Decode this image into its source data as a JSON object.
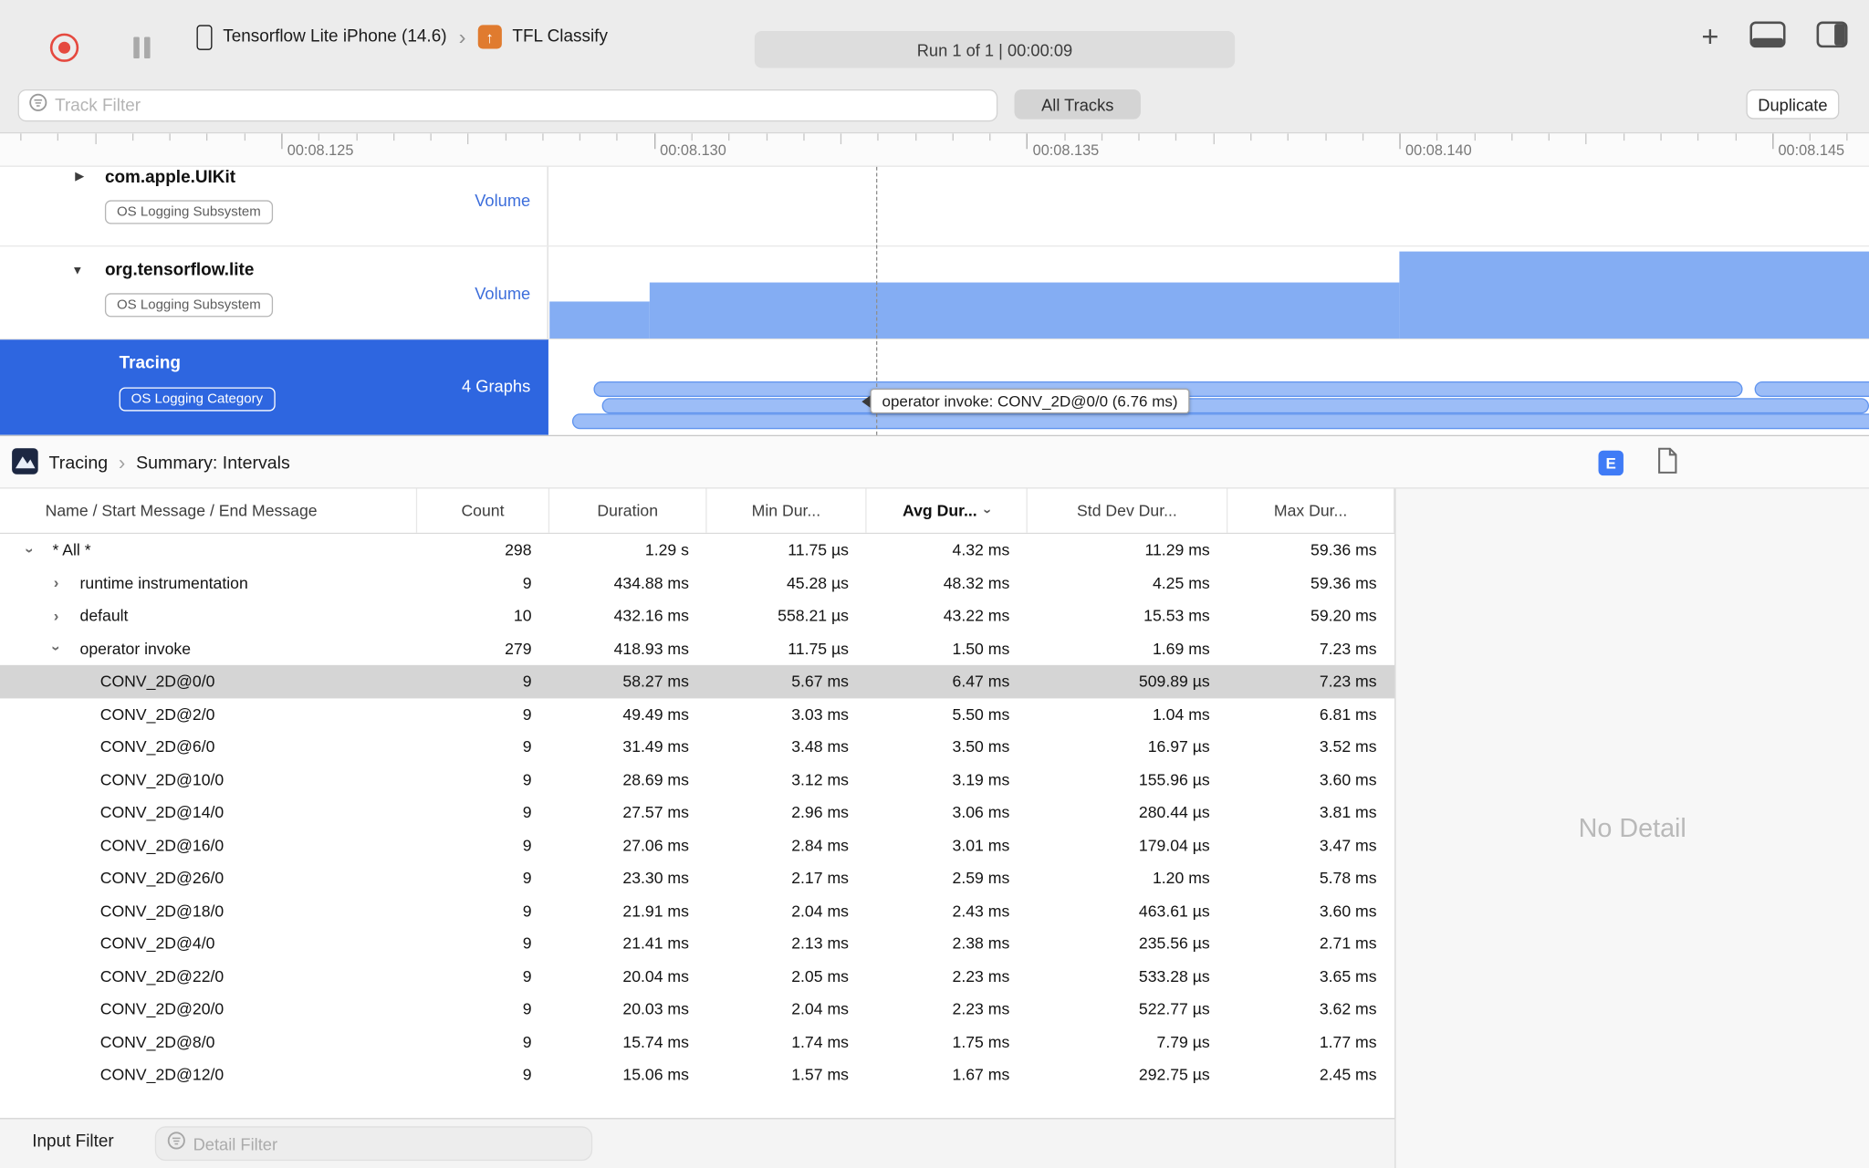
{
  "toolbar": {
    "device": "Tensorflow Lite iPhone (14.6)",
    "target": "TFL Classify",
    "run_info": "Run 1 of 1   |   00:00:09"
  },
  "filter_bar": {
    "track_filter_placeholder": "Track Filter",
    "all_tracks_label": "All Tracks",
    "duplicate_label": "Duplicate"
  },
  "ruler": {
    "labels": [
      "00:08.125",
      "00:08.130",
      "00:08.135",
      "00:08.140",
      "00:08.145"
    ]
  },
  "tracks": [
    {
      "name": "com.apple.UIKit",
      "badge": "OS Logging Subsystem",
      "meta": "Volume"
    },
    {
      "name": "org.tensorflow.lite",
      "badge": "OS Logging Subsystem",
      "meta": "Volume"
    },
    {
      "name": "Tracing",
      "badge": "OS Logging Category",
      "meta": "4 Graphs"
    }
  ],
  "tooltip": "operator invoke: CONV_2D@0/0 (6.76 ms)",
  "bottom": {
    "breadcrumb": [
      "Tracing",
      "Summary: Intervals"
    ],
    "columns": [
      {
        "label": "Name / Start Message / End Message"
      },
      {
        "label": "Count"
      },
      {
        "label": "Duration"
      },
      {
        "label": "Min Dur..."
      },
      {
        "label": "Avg Dur...",
        "sorted": true
      },
      {
        "label": "Std Dev Dur..."
      },
      {
        "label": "Max Dur..."
      }
    ],
    "rows": [
      {
        "level": 0,
        "chevron": "down",
        "name": "* All *",
        "count": "298",
        "duration": "1.29 s",
        "min": "11.75 µs",
        "avg": "4.32 ms",
        "std": "11.29 ms",
        "max": "59.36 ms"
      },
      {
        "level": 1,
        "chevron": "right",
        "name": "runtime instrumentation",
        "count": "9",
        "duration": "434.88 ms",
        "min": "45.28 µs",
        "avg": "48.32 ms",
        "std": "4.25 ms",
        "max": "59.36 ms"
      },
      {
        "level": 1,
        "chevron": "right",
        "name": "default",
        "count": "10",
        "duration": "432.16 ms",
        "min": "558.21 µs",
        "avg": "43.22 ms",
        "std": "15.53 ms",
        "max": "59.20 ms"
      },
      {
        "level": 1,
        "chevron": "down",
        "name": "operator invoke",
        "count": "279",
        "duration": "418.93 ms",
        "min": "11.75 µs",
        "avg": "1.50 ms",
        "std": "1.69 ms",
        "max": "7.23 ms"
      },
      {
        "level": 2,
        "selected": true,
        "name": "CONV_2D@0/0",
        "count": "9",
        "duration": "58.27 ms",
        "min": "5.67 ms",
        "avg": "6.47 ms",
        "std": "509.89 µs",
        "max": "7.23 ms"
      },
      {
        "level": 2,
        "name": "CONV_2D@2/0",
        "count": "9",
        "duration": "49.49 ms",
        "min": "3.03 ms",
        "avg": "5.50 ms",
        "std": "1.04 ms",
        "max": "6.81 ms"
      },
      {
        "level": 2,
        "name": "CONV_2D@6/0",
        "count": "9",
        "duration": "31.49 ms",
        "min": "3.48 ms",
        "avg": "3.50 ms",
        "std": "16.97 µs",
        "max": "3.52 ms"
      },
      {
        "level": 2,
        "name": "CONV_2D@10/0",
        "count": "9",
        "duration": "28.69 ms",
        "min": "3.12 ms",
        "avg": "3.19 ms",
        "std": "155.96 µs",
        "max": "3.60 ms"
      },
      {
        "level": 2,
        "name": "CONV_2D@14/0",
        "count": "9",
        "duration": "27.57 ms",
        "min": "2.96 ms",
        "avg": "3.06 ms",
        "std": "280.44 µs",
        "max": "3.81 ms"
      },
      {
        "level": 2,
        "name": "CONV_2D@16/0",
        "count": "9",
        "duration": "27.06 ms",
        "min": "2.84 ms",
        "avg": "3.01 ms",
        "std": "179.04 µs",
        "max": "3.47 ms"
      },
      {
        "level": 2,
        "name": "CONV_2D@26/0",
        "count": "9",
        "duration": "23.30 ms",
        "min": "2.17 ms",
        "avg": "2.59 ms",
        "std": "1.20 ms",
        "max": "5.78 ms"
      },
      {
        "level": 2,
        "name": "CONV_2D@18/0",
        "count": "9",
        "duration": "21.91 ms",
        "min": "2.04 ms",
        "avg": "2.43 ms",
        "std": "463.61 µs",
        "max": "3.60 ms"
      },
      {
        "level": 2,
        "name": "CONV_2D@4/0",
        "count": "9",
        "duration": "21.41 ms",
        "min": "2.13 ms",
        "avg": "2.38 ms",
        "std": "235.56 µs",
        "max": "2.71 ms"
      },
      {
        "level": 2,
        "name": "CONV_2D@22/0",
        "count": "9",
        "duration": "20.04 ms",
        "min": "2.05 ms",
        "avg": "2.23 ms",
        "std": "533.28 µs",
        "max": "3.65 ms"
      },
      {
        "level": 2,
        "name": "CONV_2D@20/0",
        "count": "9",
        "duration": "20.03 ms",
        "min": "2.04 ms",
        "avg": "2.23 ms",
        "std": "522.77 µs",
        "max": "3.62 ms"
      },
      {
        "level": 2,
        "name": "CONV_2D@8/0",
        "count": "9",
        "duration": "15.74 ms",
        "min": "1.74 ms",
        "avg": "1.75 ms",
        "std": "7.79 µs",
        "max": "1.77 ms"
      },
      {
        "level": 2,
        "name": "CONV_2D@12/0",
        "count": "9",
        "duration": "15.06 ms",
        "min": "1.57 ms",
        "avg": "1.67 ms",
        "std": "292.75 µs",
        "max": "2.45 ms"
      }
    ],
    "no_detail": "No Detail",
    "input_filter_label": "Input Filter",
    "detail_filter_placeholder": "Detail Filter"
  },
  "colors": {
    "selection_blue": "#2e66e0",
    "bar_blue": "#84adf3",
    "accent_icon_blue": "#3f7bf6"
  }
}
